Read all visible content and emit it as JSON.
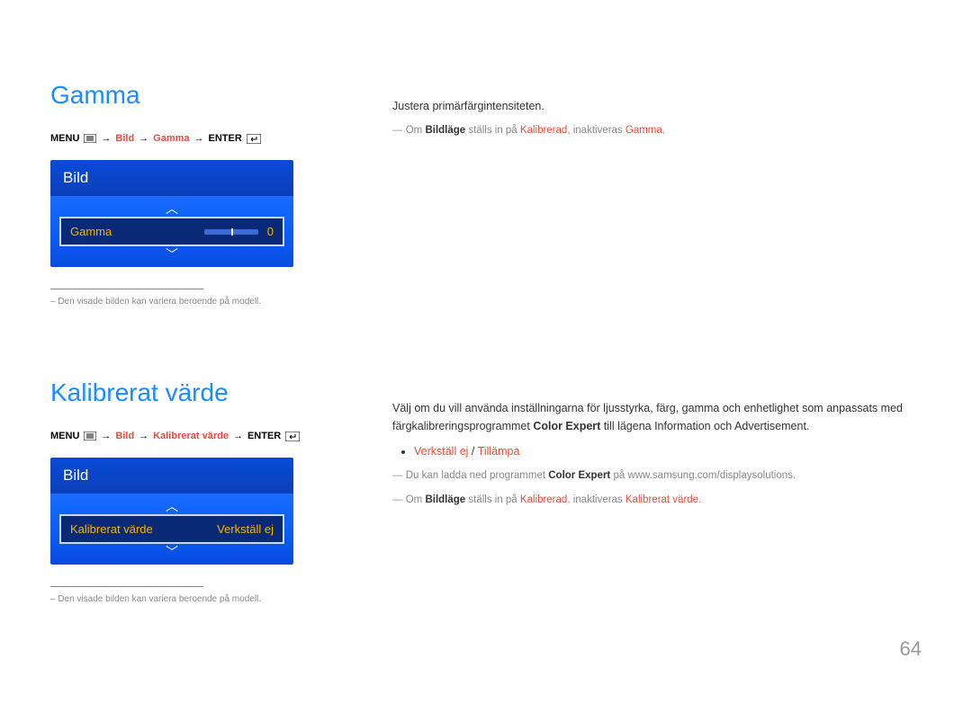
{
  "gamma": {
    "title": "Gamma",
    "breadcrumb": {
      "menu": "MENU",
      "path1": "Bild",
      "path2": "Gamma",
      "enter": "ENTER"
    },
    "osd": {
      "header": "Bild",
      "label": "Gamma",
      "value": "0"
    },
    "disclaimer": "– Den visade bilden kan variera beroende på modell.",
    "description": "Justera primärfärgintensiteten.",
    "note1_pre": "Om ",
    "note1_b1": "Bildläge",
    "note1_mid": " ställs in på ",
    "note1_r1": "Kalibrerad",
    "note1_mid2": ", inaktiveras ",
    "note1_r2": "Gamma",
    "note1_end": "."
  },
  "calibrated": {
    "title": "Kalibrerat värde",
    "breadcrumb": {
      "menu": "MENU",
      "path1": "Bild",
      "path2": "Kalibrerat värde",
      "enter": "ENTER"
    },
    "osd": {
      "header": "Bild",
      "label": "Kalibrerat värde",
      "value": "Verkställ ej"
    },
    "disclaimer": "– Den visade bilden kan variera beroende på modell.",
    "description_pre": "Välj om du vill använda inställningarna för ljusstyrka, färg, gamma och enhetlighet som anpassats med färgkalibreringsprogrammet ",
    "description_b": "Color Expert",
    "description_post": " till lägena Information och Advertisement.",
    "option1": "Verkställ ej",
    "option_sep": " / ",
    "option2": "Tillämpa",
    "note1_pre": "Du kan ladda ned programmet ",
    "note1_b": "Color Expert",
    "note1_post": " på www.samsung.com/displaysolutions.",
    "note2_pre": "Om ",
    "note2_b1": "Bildläge",
    "note2_mid": " ställs in på ",
    "note2_r1": "Kalibrerad",
    "note2_mid2": ", inaktiveras ",
    "note2_r2": "Kalibrerat värde",
    "note2_end": "."
  },
  "page_number": "64"
}
